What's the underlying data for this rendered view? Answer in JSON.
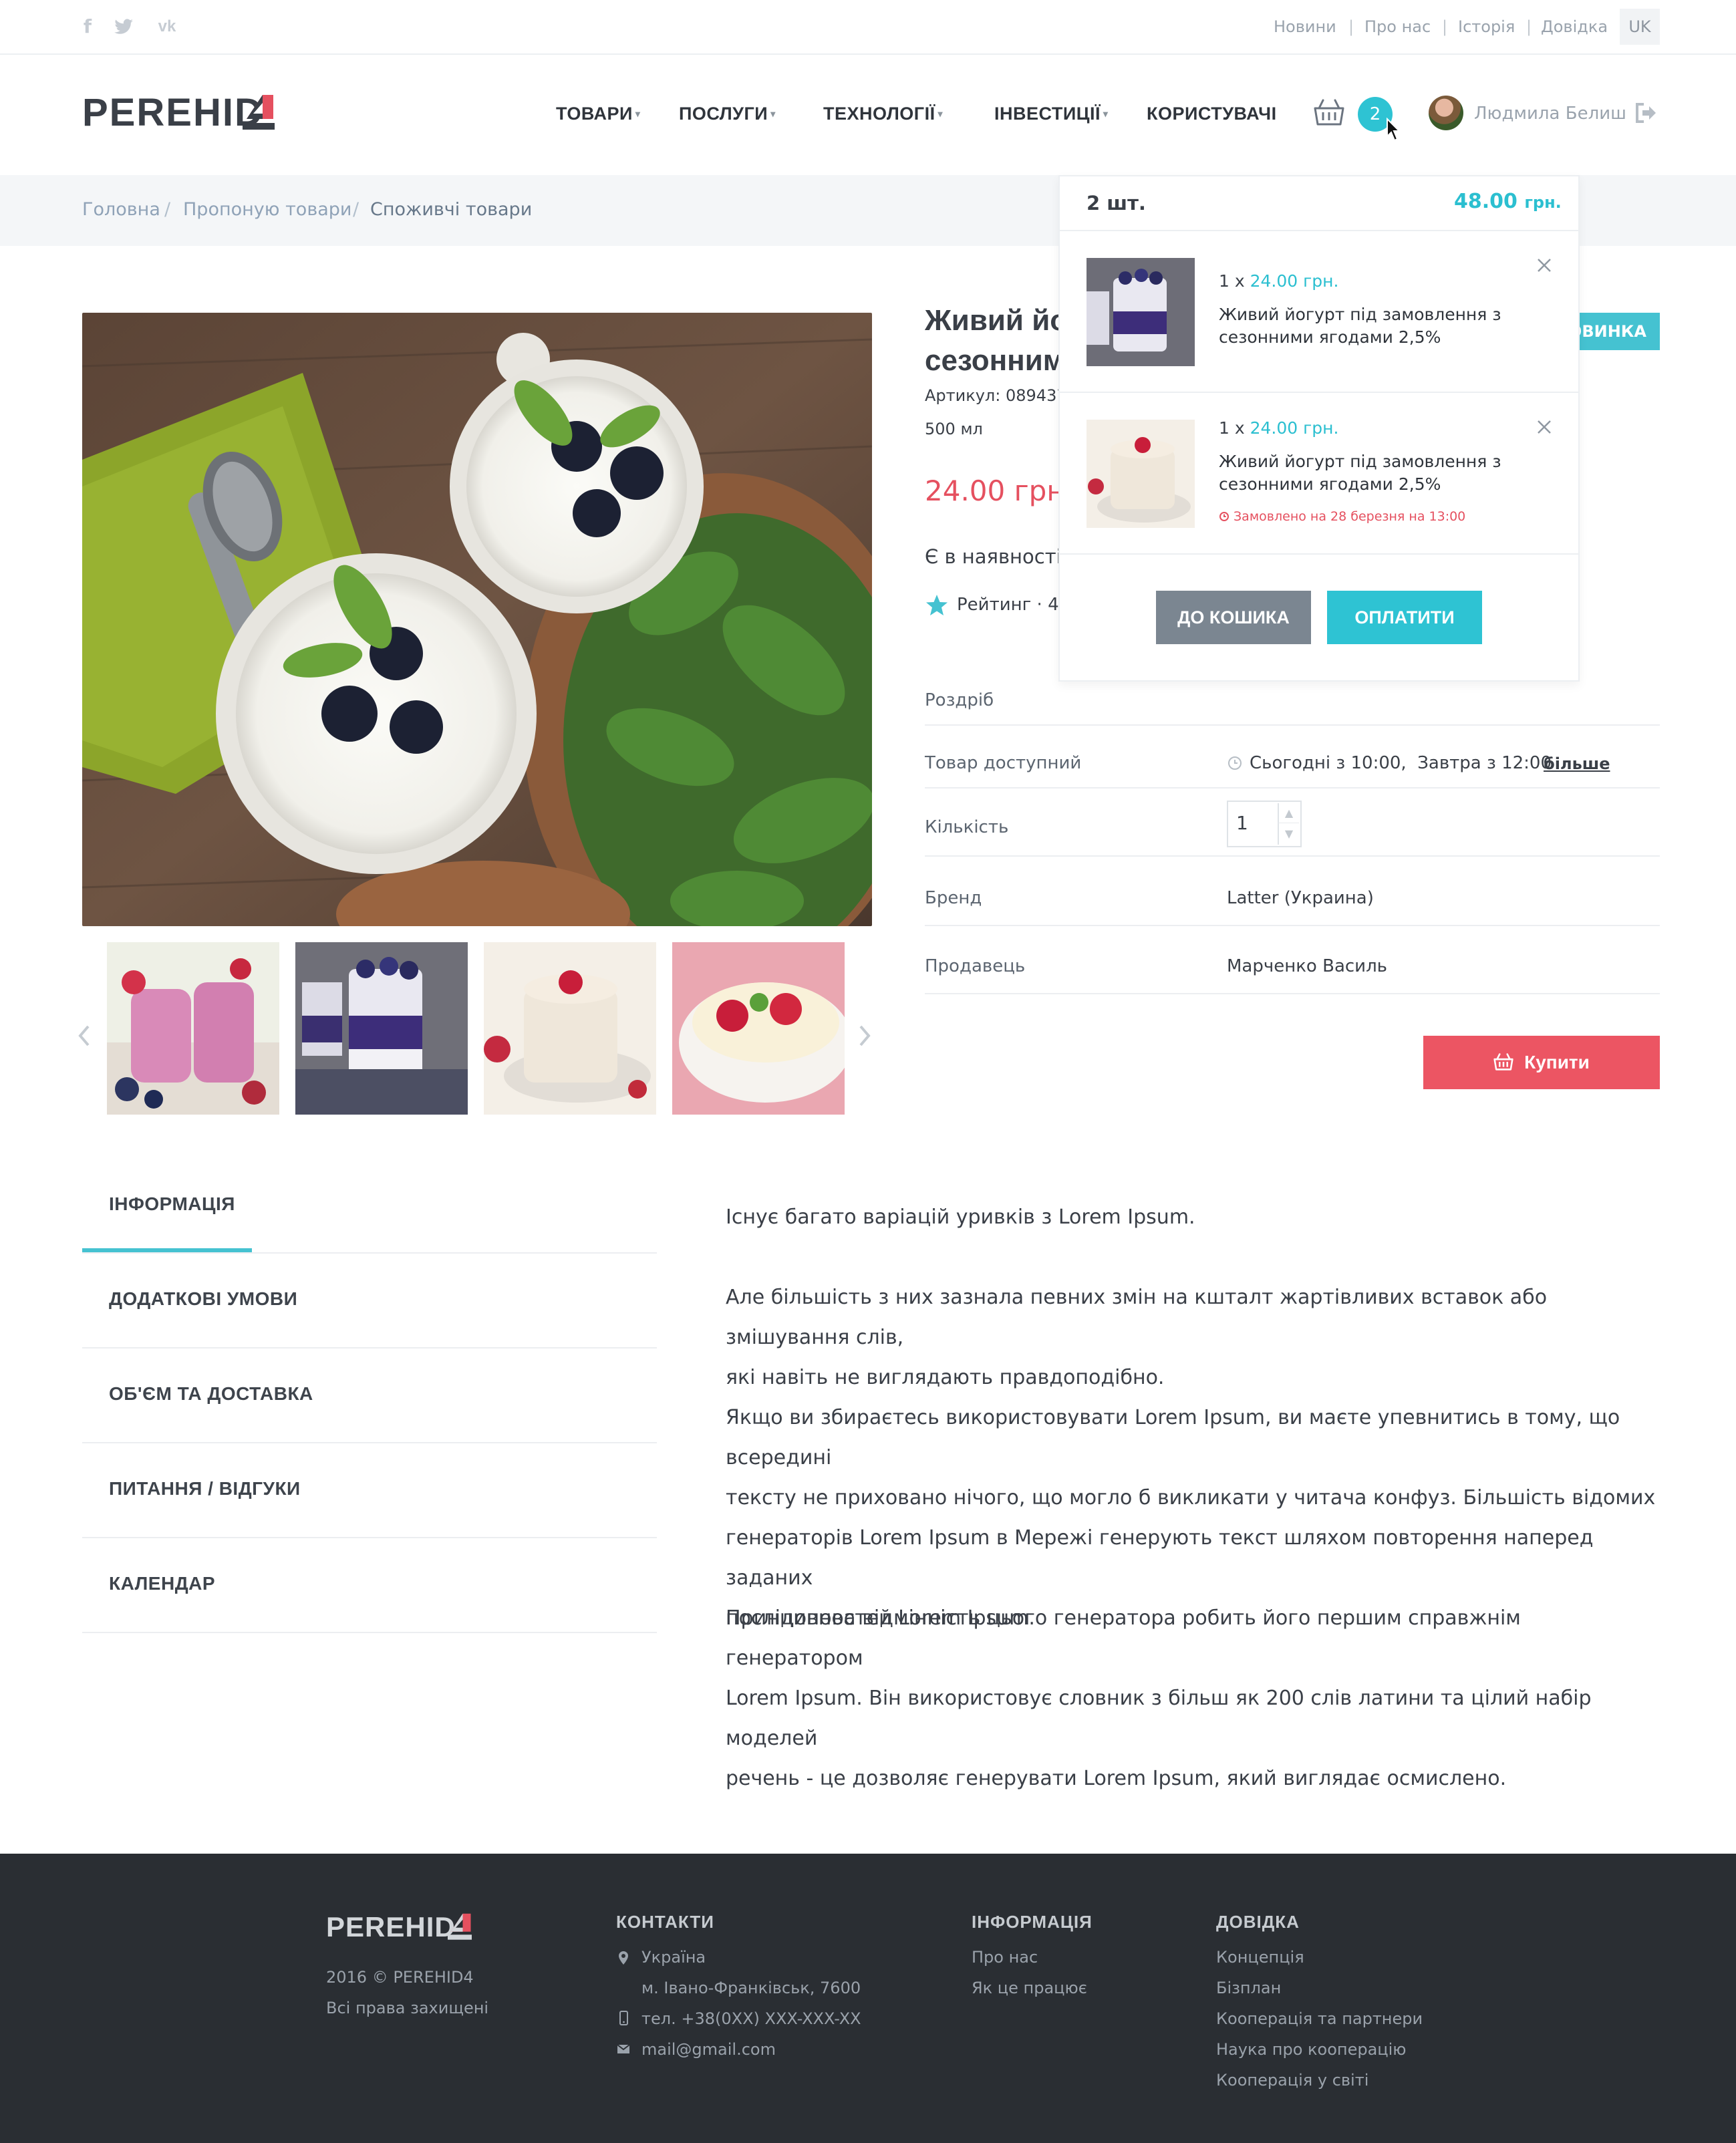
{
  "topbar": {
    "social": [
      "facebook-icon",
      "twitter-icon",
      "vk-icon"
    ],
    "links": [
      "Новини",
      "Про нас",
      "Історія",
      "Довідка"
    ],
    "lang": "UK"
  },
  "header": {
    "logo": "PEREHID",
    "nav": [
      "ТОВАРИ",
      "ПОСЛУГИ",
      "ТЕХНОЛОГІЇ",
      "ІНВЕСТИЦІЇ",
      "КОРИСТУВАЧІ"
    ],
    "cart_count": "2",
    "user_name": "Людмила Белиш"
  },
  "breadcrumb": [
    "Головна",
    "Пропоную товари",
    "Споживчі товари"
  ],
  "product": {
    "title_line1": "Живий йогурт під замовлення з",
    "title_line2": "сезонними ягодами 2,5%",
    "sku": "Артикул: 089437",
    "volume": "500 мл",
    "price": "24.00 грн.",
    "stock": "Є в наявності",
    "rating": "Рейтинг · 4,8",
    "badge": "НОВИНКА",
    "rows": [
      {
        "label": "Роздріб",
        "value": ""
      },
      {
        "label": "Товар доступний",
        "value": "Сьогодні з 10:00,  Завтра з 12:00",
        "link": "більше"
      },
      {
        "label": "Кількість",
        "value": "1"
      },
      {
        "label": "Бренд",
        "value": "Latter (Украина)"
      },
      {
        "label": "Продавець",
        "value": "Марченко Василь"
      }
    ],
    "buy_label": "Купити"
  },
  "cart_dropdown": {
    "count": "2 шт.",
    "total": "48.00",
    "total_unit": "грн.",
    "items": [
      {
        "qty": "1 x",
        "price": "24.00 грн.",
        "name": "Живий йогурт під замовлення з сезонними ягодами 2,5%"
      },
      {
        "qty": "1 x",
        "price": "24.00 грн.",
        "name": "Живий йогурт під замовлення з сезонними ягодами 2,5%",
        "note_prefix": "Замовлено на",
        "note_date": "28 березня",
        "note_mid": "на",
        "note_time": "13:00"
      }
    ],
    "to_cart": "ДО КОШИКА",
    "pay": "ОПЛАТИТИ"
  },
  "tabs": [
    "ІНФОРМАЦІЯ",
    "ДОДАТКОВІ УМОВИ",
    "ОБ'ЄМ ТА ДОСТАВКА",
    "ПИТАННЯ / ВІДГУКИ",
    "КАЛЕНДАР"
  ],
  "description": {
    "heading": "Існує багато варіацій уривків з Lorem Ipsum.",
    "p1_l1": "Але більшість з них зазнала певних змін на кшталт жартівливих вставок або змішування слів,",
    "p1_l2": "які навіть не виглядають правдоподібно.",
    "p2_l1": "Якщо ви збираєтесь використовувати Lorem Ipsum, ви маєте упевнитись в тому, що всередині",
    "p2_l2": "тексту не приховано нічого, що могло б викликати у читача конфуз. Більшість відомих",
    "p2_l3": "генераторів Lorem Ipsum в Мережі генерують текст шляхом повторення наперед заданих",
    "p2_l4": "послідовностей Lorem Ipsum.",
    "p3_l1": "Принципова відмінність цього генератора робить його першим справжнім генератором",
    "p3_l2": "Lorem Ipsum. Він використовує словник з більш як 200 слів латини та цілий набір моделей",
    "p3_l3": "речень - це дозволяє генерувати Lorem Ipsum, який виглядає осмислено."
  },
  "footer": {
    "logo": "PEREHID",
    "copyright": "2016 © PEREHID4",
    "rights": "Всі права захищені",
    "contacts_title": "КОНТАКТИ",
    "country": "Україна",
    "city": "м. Івано-Франківськ, 7600",
    "phone": "тел. +38(0XX) XXX-XXX-XX",
    "email": "mail@gmail.com",
    "info_title": "ІНФОРМАЦІЯ",
    "info_links": [
      "Про нас",
      "Як це працює"
    ],
    "help_title": "ДОВІДКА",
    "help_links": [
      "Концепція",
      "Бізплан",
      "Кооперація та партнери",
      "Наука про кооперацію",
      "Кооперація у світі"
    ]
  },
  "colors": {
    "accent": "#2ec3d3",
    "buy": "#ec5563",
    "price": "#e5505f",
    "footer": "#2a2e33",
    "logo_red": "#e5505f"
  }
}
